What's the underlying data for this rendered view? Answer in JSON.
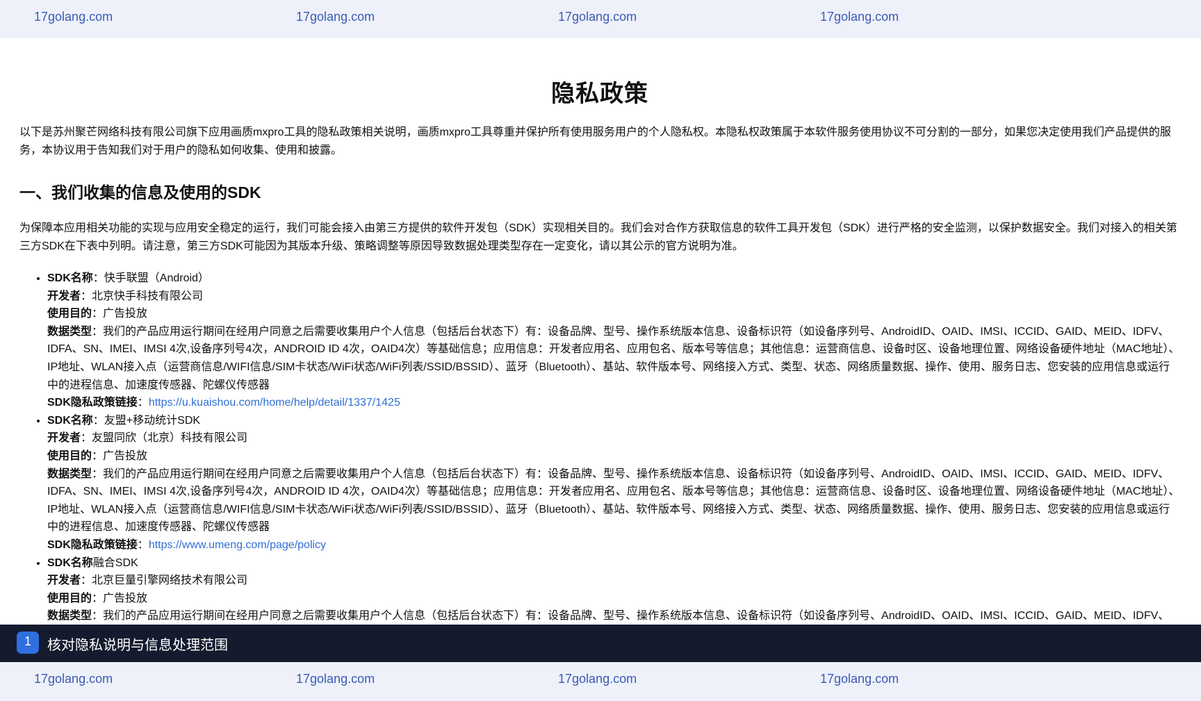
{
  "watermark": {
    "top": [
      "17golang.com",
      "17golang.com",
      "17golang.com",
      "17golang.com"
    ],
    "bottom": [
      "17golang.com",
      "17golang.com",
      "17golang.com",
      "17golang.com"
    ]
  },
  "page": {
    "title": "隐私政策",
    "intro": "以下是苏州聚芒网络科技有限公司旗下应用画质mxpro工具的隐私政策相关说明，画质mxpro工具尊重并保护所有使用服务用户的个人隐私权。本隐私权政策属于本软件服务使用协议不可分割的一部分，如果您决定使用我们产品提供的服务，本协议用于告知我们对于用户的隐私如何收集、使用和披露。",
    "section1_heading": "一、我们收集的信息及使用的SDK",
    "section1_para": "为保障本应用相关功能的实现与应用安全稳定的运行，我们可能会接入由第三方提供的软件开发包（SDK）实现相关目的。我们会对合作方获取信息的软件工具开发包（SDK）进行严格的安全监测，以保护数据安全。我们对接入的相关第三方SDK在下表中列明。请注意，第三方SDK可能因为其版本升级、策略调整等原因导致数据处理类型存在一定变化，请以其公示的官方说明为准。"
  },
  "sdks": [
    {
      "name_label": "SDK名称",
      "name": "：快手联盟（Android）",
      "dev_label": "开发者",
      "dev": "：北京快手科技有限公司",
      "purpose_label": "使用目的",
      "purpose": "：广告投放",
      "data_label": "数据类型",
      "data": "：我们的产品应用运行期间在经用户同意之后需要收集用户个人信息（包括后台状态下）有：设备品牌、型号、操作系统版本信息、设备标识符（如设备序列号、AndroidID、OAID、IMSI、ICCID、GAID、MEID、IDFV、IDFA、SN、IMEI、IMSI 4次,设备序列号4次，ANDROID ID 4次，OAID4次）等基础信息；应用信息：开发者应用名、应用包名、版本号等信息；其他信息：运营商信息、设备时区、设备地理位置、网络设备硬件地址（MAC地址）、IP地址、WLAN接入点（运营商信息/WIFI信息/SIM卡状态/WiFi状态/WiFi列表/SSID/BSSID）、蓝牙（Bluetooth）、基站、软件版本号、网络接入方式、类型、状态、网络质量数据、操作、使用、服务日志、您安装的应用信息或运行中的进程信息、加速度传感器、陀螺仪传感器",
      "link_label": "SDK隐私政策链接",
      "link_sep": "：",
      "link": "https://u.kuaishou.com/home/help/detail/1337/1425"
    },
    {
      "name_label": "SDK名称",
      "name": "：友盟+移动统计SDK",
      "dev_label": "开发者",
      "dev": "：友盟同欣（北京）科技有限公司",
      "purpose_label": "使用目的",
      "purpose": "：广告投放",
      "data_label": "数据类型",
      "data": "：我们的产品应用运行期间在经用户同意之后需要收集用户个人信息（包括后台状态下）有：设备品牌、型号、操作系统版本信息、设备标识符（如设备序列号、AndroidID、OAID、IMSI、ICCID、GAID、MEID、IDFV、IDFA、SN、IMEI、IMSI 4次,设备序列号4次，ANDROID ID 4次，OAID4次）等基础信息；应用信息：开发者应用名、应用包名、版本号等信息；其他信息：运营商信息、设备时区、设备地理位置、网络设备硬件地址（MAC地址）、IP地址、WLAN接入点（运营商信息/WIFI信息/SIM卡状态/WiFi状态/WiFi列表/SSID/BSSID）、蓝牙（Bluetooth）、基站、软件版本号、网络接入方式、类型、状态、网络质量数据、操作、使用、服务日志、您安装的应用信息或运行中的进程信息、加速度传感器、陀螺仪传感器",
      "link_label": "SDK隐私政策链接",
      "link_sep": "：",
      "link": "https://www.umeng.com/page/policy"
    },
    {
      "name_label": "SDK名称",
      "name": "融合SDK",
      "dev_label": "开发者",
      "dev": "：北京巨量引擎网络技术有限公司",
      "purpose_label": "使用目的",
      "purpose": "：广告投放",
      "data_label": "数据类型",
      "data": "：我们的产品应用运行期间在经用户同意之后需要收集用户个人信息（包括后台状态下）有：设备品牌、型号、操作系统版本信息、设备标识符（如设备序列号、AndroidID、OAID、IMSI、ICCID、GAID、MEID、IDFV、IDFA、SN、IMEI、IMSI 4次,设备序列号4次，ANDROID ID 4次，OAID4次）等基础信息；应用信息：开发者应用名、应用包名、版本号等信息；其他信息：运营商信息、设备时区、设备地理位置、网络设备硬件地址（MAC地址）"
    }
  ],
  "caption": {
    "step": "1",
    "text": "核对隐私说明与信息处理范围"
  }
}
